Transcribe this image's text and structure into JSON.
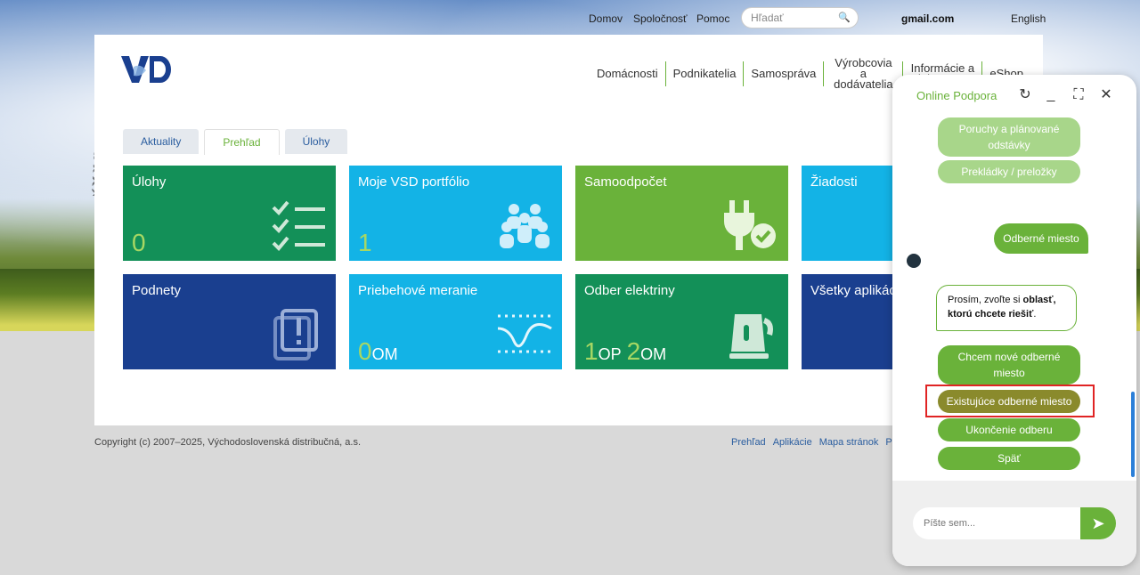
{
  "topbar": {
    "links": [
      "Domov",
      "Spoločnosť",
      "Pomoc"
    ],
    "search_placeholder": "Hľadať",
    "email": "gmail.com",
    "language": "English"
  },
  "header": {
    "logo_text": "VSD",
    "nav": [
      {
        "label": "Domácnosti"
      },
      {
        "label": "Podnikatelia"
      },
      {
        "label": "Samospráva"
      },
      {
        "label": "Výrobcovia a dodávatelia"
      },
      {
        "label": "Informácie a dokumenty"
      },
      {
        "label": "eShop"
      }
    ]
  },
  "tabs": [
    "Aktuality",
    "Prehľad",
    "Úlohy"
  ],
  "tiles": [
    {
      "title": "Úlohy",
      "count": "0",
      "unit": "",
      "count2": "",
      "unit2": "",
      "color": "#139058",
      "icon": "checklist-icon"
    },
    {
      "title": "Moje VSD portfólio",
      "count": "1",
      "unit": "",
      "count2": "",
      "unit2": "",
      "color": "#13b3e6",
      "icon": "people-icon"
    },
    {
      "title": "Samoodpočet",
      "count": "",
      "unit": "",
      "count2": "",
      "unit2": "",
      "color": "#6ab23a",
      "icon": "plug-icon"
    },
    {
      "title": "Žiadosti",
      "count": "",
      "unit": "",
      "count2": "",
      "unit2": "",
      "color": "#13b3e6",
      "icon": "request-icon"
    },
    {
      "title": "Podnety",
      "count": "",
      "unit": "",
      "count2": "",
      "unit2": "",
      "color": "#1a3f8f",
      "icon": "alert-icon"
    },
    {
      "title": "Priebehové meranie",
      "count": "0",
      "unit": "OM",
      "count2": "",
      "unit2": "",
      "color": "#13b3e6",
      "icon": "wave-icon"
    },
    {
      "title": "Odber elektriny",
      "count": "1",
      "unit": "OP",
      "count2": "2",
      "unit2": "OM",
      "color": "#139058",
      "icon": "kettle-icon"
    },
    {
      "title": "Všetky aplikácie",
      "count": "",
      "unit": "",
      "count2": "",
      "unit2": "",
      "color": "#1a3f8f",
      "icon": "apps-icon"
    }
  ],
  "footer": {
    "copyright": "Copyright (c) 2007–2025, Východoslovenská distribučná, a.s.",
    "links": [
      "Prehľad",
      "Aplikácie",
      "Mapa stránok",
      "Po"
    ]
  },
  "chat": {
    "title": "Online Podpora",
    "options_top": [
      "Poruchy a plánované odstávky",
      "Prekládky / preložky"
    ],
    "user_message": "Odberné miesto",
    "bot_message_prefix": "Prosím, zvoľte si ",
    "bot_message_bold": "oblasť, ktorú chcete riešiť",
    "bot_message_suffix": ".",
    "options": [
      "Chcem nové odberné miesto",
      "Existujúce odberné miesto",
      "Ukončenie odberu",
      "Späť"
    ],
    "input_placeholder": "Píšte sem..."
  }
}
